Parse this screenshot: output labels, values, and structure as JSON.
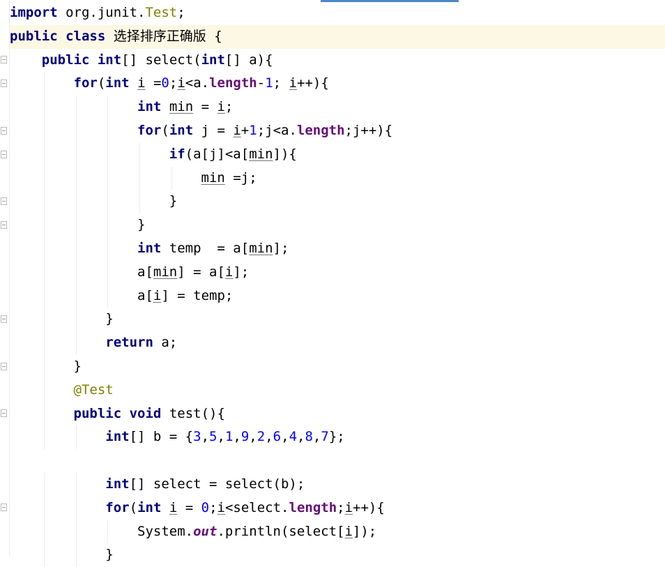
{
  "editor": {
    "lines": [
      {
        "indent": 0,
        "highlight": false,
        "tokens": [
          {
            "t": "import",
            "c": "kw"
          },
          {
            "t": " org.junit."
          },
          {
            "t": "Test",
            "c": "ref"
          },
          {
            "t": ";"
          }
        ]
      },
      {
        "indent": 0,
        "highlight": true,
        "tokens": [
          {
            "t": "public",
            "c": "kw"
          },
          {
            "t": " "
          },
          {
            "t": "class",
            "c": "kw"
          },
          {
            "t": " "
          },
          {
            "t": "选择排序正确版",
            "c": "zh"
          },
          {
            "t": " {"
          }
        ]
      },
      {
        "indent": 1,
        "highlight": false,
        "tokens": [
          {
            "t": "public",
            "c": "kw"
          },
          {
            "t": " "
          },
          {
            "t": "int",
            "c": "kw"
          },
          {
            "t": "[] select("
          },
          {
            "t": "int",
            "c": "kw"
          },
          {
            "t": "[] a){"
          }
        ]
      },
      {
        "indent": 2,
        "highlight": false,
        "tokens": [
          {
            "t": "for",
            "c": "kw"
          },
          {
            "t": "("
          },
          {
            "t": "int",
            "c": "kw"
          },
          {
            "t": " "
          },
          {
            "t": "i",
            "c": "u"
          },
          {
            "t": " ="
          },
          {
            "t": "0",
            "c": "num"
          },
          {
            "t": ";"
          },
          {
            "t": "i",
            "c": "u"
          },
          {
            "t": "<a."
          },
          {
            "t": "length",
            "c": "field"
          },
          {
            "t": "-"
          },
          {
            "t": "1",
            "c": "num"
          },
          {
            "t": "; "
          },
          {
            "t": "i",
            "c": "u"
          },
          {
            "t": "++){"
          }
        ]
      },
      {
        "indent": 4,
        "highlight": false,
        "tokens": [
          {
            "t": "int",
            "c": "kw"
          },
          {
            "t": " "
          },
          {
            "t": "min",
            "c": "u"
          },
          {
            "t": " = "
          },
          {
            "t": "i",
            "c": "u"
          },
          {
            "t": ";"
          }
        ]
      },
      {
        "indent": 4,
        "highlight": false,
        "tokens": [
          {
            "t": "for",
            "c": "kw"
          },
          {
            "t": "("
          },
          {
            "t": "int",
            "c": "kw"
          },
          {
            "t": " j = "
          },
          {
            "t": "i",
            "c": "u"
          },
          {
            "t": "+"
          },
          {
            "t": "1",
            "c": "num"
          },
          {
            "t": ";j<a."
          },
          {
            "t": "length",
            "c": "field"
          },
          {
            "t": ";j++){"
          }
        ]
      },
      {
        "indent": 5,
        "highlight": false,
        "tokens": [
          {
            "t": "if",
            "c": "kw"
          },
          {
            "t": "(a[j]<a["
          },
          {
            "t": "min",
            "c": "u"
          },
          {
            "t": "]){"
          }
        ]
      },
      {
        "indent": 6,
        "highlight": false,
        "tokens": [
          {
            "t": "min",
            "c": "u"
          },
          {
            "t": " =j;"
          }
        ]
      },
      {
        "indent": 5,
        "highlight": false,
        "tokens": [
          {
            "t": "}"
          }
        ]
      },
      {
        "indent": 4,
        "highlight": false,
        "tokens": [
          {
            "t": "}"
          }
        ]
      },
      {
        "indent": 4,
        "highlight": false,
        "tokens": [
          {
            "t": "int",
            "c": "kw"
          },
          {
            "t": " temp  = a["
          },
          {
            "t": "min",
            "c": "u"
          },
          {
            "t": "];"
          }
        ]
      },
      {
        "indent": 4,
        "highlight": false,
        "tokens": [
          {
            "t": "a["
          },
          {
            "t": "min",
            "c": "u"
          },
          {
            "t": "] = a["
          },
          {
            "t": "i",
            "c": "u"
          },
          {
            "t": "];"
          }
        ]
      },
      {
        "indent": 4,
        "highlight": false,
        "tokens": [
          {
            "t": "a["
          },
          {
            "t": "i",
            "c": "u"
          },
          {
            "t": "] = temp;"
          }
        ]
      },
      {
        "indent": 3,
        "highlight": false,
        "tokens": [
          {
            "t": "}"
          }
        ]
      },
      {
        "indent": 3,
        "highlight": false,
        "tokens": [
          {
            "t": "return",
            "c": "kw"
          },
          {
            "t": " a;"
          }
        ]
      },
      {
        "indent": 2,
        "highlight": false,
        "tokens": [
          {
            "t": "}"
          }
        ]
      },
      {
        "indent": 2,
        "highlight": false,
        "tokens": [
          {
            "t": "@Test",
            "c": "annot"
          }
        ]
      },
      {
        "indent": 2,
        "highlight": false,
        "tokens": [
          {
            "t": "public",
            "c": "kw"
          },
          {
            "t": " "
          },
          {
            "t": "void",
            "c": "kw"
          },
          {
            "t": " test(){"
          }
        ]
      },
      {
        "indent": 3,
        "highlight": false,
        "tokens": [
          {
            "t": "int",
            "c": "kw"
          },
          {
            "t": "[] b = {"
          },
          {
            "t": "3",
            "c": "num"
          },
          {
            "t": ","
          },
          {
            "t": "5",
            "c": "num"
          },
          {
            "t": ","
          },
          {
            "t": "1",
            "c": "num"
          },
          {
            "t": ","
          },
          {
            "t": "9",
            "c": "num"
          },
          {
            "t": ","
          },
          {
            "t": "2",
            "c": "num"
          },
          {
            "t": ","
          },
          {
            "t": "6",
            "c": "num"
          },
          {
            "t": ","
          },
          {
            "t": "4",
            "c": "num"
          },
          {
            "t": ","
          },
          {
            "t": "8",
            "c": "num"
          },
          {
            "t": ","
          },
          {
            "t": "7",
            "c": "num"
          },
          {
            "t": "};"
          }
        ]
      },
      {
        "indent": 0,
        "highlight": false,
        "tokens": []
      },
      {
        "indent": 3,
        "highlight": false,
        "tokens": [
          {
            "t": "int",
            "c": "kw"
          },
          {
            "t": "[] select = select(b);"
          }
        ]
      },
      {
        "indent": 3,
        "highlight": false,
        "tokens": [
          {
            "t": "for",
            "c": "kw"
          },
          {
            "t": "("
          },
          {
            "t": "int",
            "c": "kw"
          },
          {
            "t": " "
          },
          {
            "t": "i",
            "c": "u"
          },
          {
            "t": " = "
          },
          {
            "t": "0",
            "c": "num"
          },
          {
            "t": ";"
          },
          {
            "t": "i",
            "c": "u"
          },
          {
            "t": "<select."
          },
          {
            "t": "length",
            "c": "field"
          },
          {
            "t": ";"
          },
          {
            "t": "i",
            "c": "u"
          },
          {
            "t": "++){"
          }
        ]
      },
      {
        "indent": 4,
        "highlight": false,
        "tokens": [
          {
            "t": "System."
          },
          {
            "t": "out",
            "c": "static"
          },
          {
            "t": ".println(select["
          },
          {
            "t": "i",
            "c": "u"
          },
          {
            "t": "]);"
          }
        ]
      },
      {
        "indent": 3,
        "highlight": false,
        "tokens": [
          {
            "t": "}"
          }
        ]
      }
    ]
  }
}
